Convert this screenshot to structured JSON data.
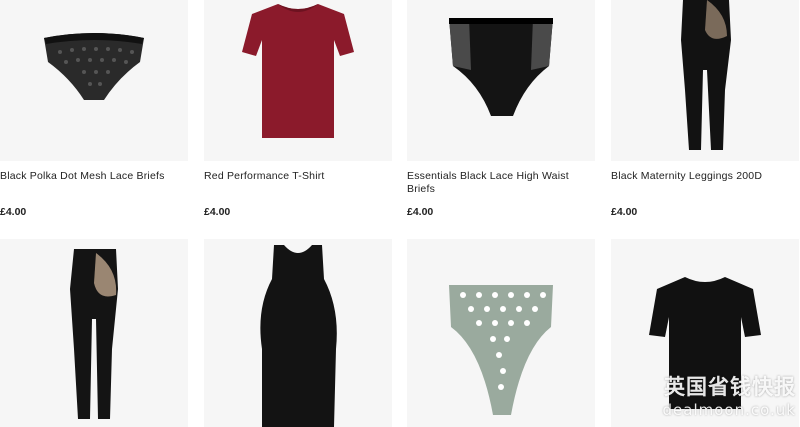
{
  "products": [
    {
      "title": "Black Polka Dot Mesh Lace Briefs",
      "price": "£4.00",
      "image": "black-lace-briefs-image"
    },
    {
      "title": "Red Performance T-Shirt",
      "price": "£4.00",
      "image": "red-tshirt-image"
    },
    {
      "title": "Essentials Black Lace High Waist Briefs",
      "price": "£4.00",
      "image": "black-high-waist-briefs-image"
    },
    {
      "title": "Black Maternity Leggings 200D",
      "price": "£4.00",
      "image": "black-maternity-leggings-image"
    },
    {
      "image": "black-maternity-tights-image"
    },
    {
      "image": "black-maternity-dress-image"
    },
    {
      "image": "sage-polka-dot-bikini-briefs-image"
    },
    {
      "image": "black-tshirt-image"
    }
  ],
  "watermark": {
    "line1": "英国省钱快报",
    "line2": "dealmoon.co.uk"
  },
  "colors": {
    "card_bg": "#f6f6f6",
    "text": "#222222",
    "red": "#8b1a2b",
    "sage": "#9aaa9e"
  }
}
